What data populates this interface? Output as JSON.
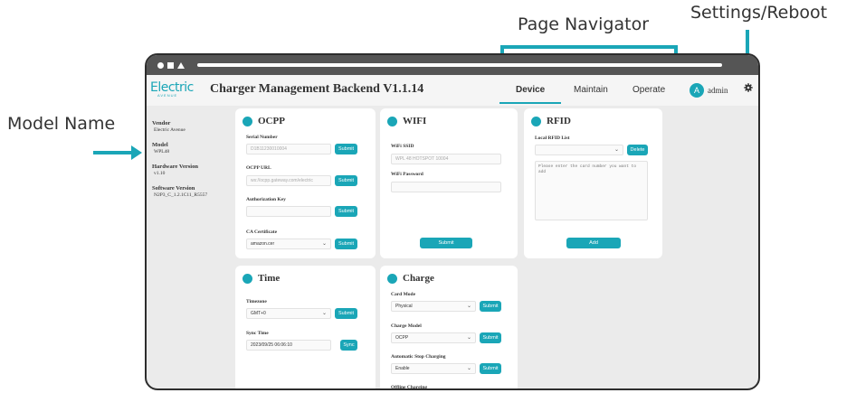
{
  "callouts": {
    "page_navigator": "Page Navigator",
    "settings_reboot": "Settings/Reboot",
    "model_name": "Model Name"
  },
  "colors": {
    "accent": "#1aa6b7",
    "window_bar": "#555555"
  },
  "app": {
    "logo_text": "Electric",
    "logo_sub": "AVENUE",
    "title": "Charger Management Backend V1.1.14",
    "tabs": [
      "Device",
      "Maintain",
      "Operate"
    ],
    "active_tab": "Device",
    "avatar_initial": "A",
    "username": "admin"
  },
  "sidebar": {
    "vendor_label": "Vendor",
    "vendor_value": "Electric Avenue",
    "model_label": "Model",
    "model_value": "WPL48",
    "hw_label": "Hardware Version",
    "hw_value": "v1.10",
    "sw_label": "Software Version",
    "sw_value": "N2P3_C_1.2.1C11_R5557"
  },
  "ocpp": {
    "title": "OCPP",
    "serial_label": "Serial Number",
    "serial_placeholder": "D1B11230010004",
    "url_label": "OCPP URL",
    "url_placeholder": "ws://ocpp.gateway.com/electric",
    "auth_label": "Authorization Key",
    "ca_label": "CA Certificate",
    "ca_value": "amazon.cer",
    "submit": "Submit"
  },
  "wifi": {
    "title": "WIFI",
    "ssid_label": "WiFi SSID",
    "ssid_placeholder": "WPL 48 HOTSPOT 10004",
    "password_label": "WiFi Password",
    "submit": "Submit"
  },
  "rfid": {
    "title": "RFID",
    "list_label": "Local RFID List",
    "delete": "Delete",
    "textarea_placeholder": "Please enter the card number you want to add",
    "add": "Add"
  },
  "time": {
    "title": "Time",
    "tz_label": "Timezone",
    "tz_value": "GMT+0",
    "sync_label": "Sync Time",
    "sync_value": "2023/09/25 06:06:10",
    "submit": "Submit",
    "sync": "Sync"
  },
  "charge": {
    "title": "Charge",
    "card_mode_label": "Card Mode",
    "card_mode_value": "Physical",
    "charge_model_label": "Charge Model",
    "charge_model_value": "OCPP",
    "auto_stop_label": "Automatic Stop Charging",
    "auto_stop_value": "Enable",
    "offline_label": "Offline Charging",
    "submit": "Submit"
  }
}
